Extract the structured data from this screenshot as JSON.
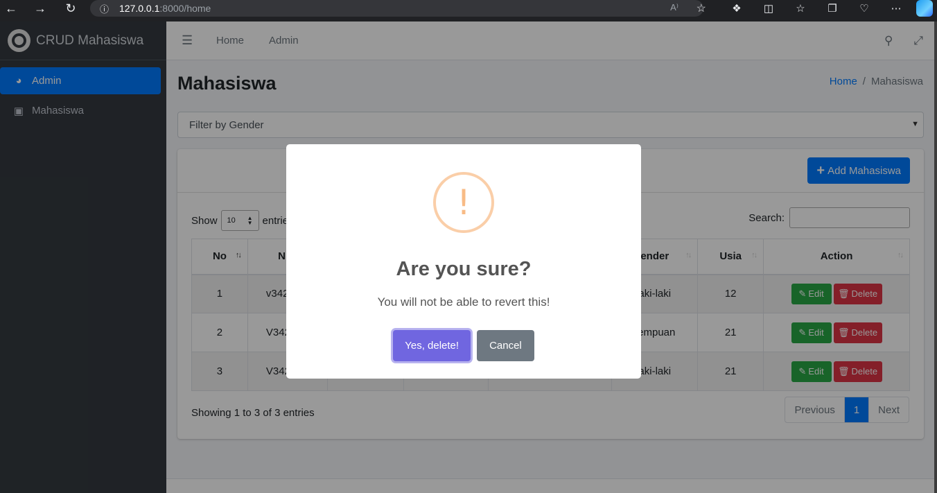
{
  "browser": {
    "url_host": "127.0.0.1",
    "url_path": ":8000/home"
  },
  "sidebar": {
    "brand": "CRUD Mahasiswa",
    "items": [
      {
        "label": "Admin",
        "icon": "dashboard-icon",
        "active": true
      },
      {
        "label": "Mahasiswa",
        "icon": "box-icon",
        "active": false
      }
    ]
  },
  "navbar": {
    "links": [
      "Home",
      "Admin"
    ]
  },
  "page": {
    "title": "Mahasiswa",
    "breadcrumb": {
      "home": "Home",
      "separator": "/",
      "current": "Mahasiswa"
    }
  },
  "filter": {
    "label": "Filter by Gender"
  },
  "card": {
    "add_button": "Add Mahasiswa",
    "show_label": "Show",
    "entries_label": "entries",
    "page_length": "10",
    "search_label": "Search:"
  },
  "table": {
    "headers": [
      "No",
      "NIM",
      "",
      "",
      "",
      "Gender",
      "Usia",
      "Action"
    ],
    "visible_headers": {
      "no": "No",
      "nim": "NIM",
      "gender": "ender",
      "usia": "Usia",
      "action": "Action"
    },
    "rows": [
      {
        "no": "1",
        "nim": "v342",
        "gender": "aki-laki",
        "usia": "12"
      },
      {
        "no": "2",
        "nim": "V342",
        "gender": "rempuan",
        "usia": "21"
      },
      {
        "no": "3",
        "nim": "V342",
        "gender": "aki-laki",
        "usia": "21"
      }
    ],
    "edit_label": "Edit",
    "delete_label": "Delete"
  },
  "footer_info": "Showing 1 to 3 of 3 entries",
  "pagination": {
    "previous": "Previous",
    "current": "1",
    "next": "Next"
  },
  "modal": {
    "icon": "!",
    "title": "Are you sure?",
    "text": "You will not be able to revert this!",
    "confirm": "Yes, delete!",
    "cancel": "Cancel"
  },
  "colors": {
    "primary": "#007bff",
    "sidebar_bg": "#343a40",
    "confirm": "#7066e0",
    "cancel": "#6e7881",
    "edit": "#28a745",
    "delete": "#dc3545",
    "warning_ring": "#facea8"
  }
}
